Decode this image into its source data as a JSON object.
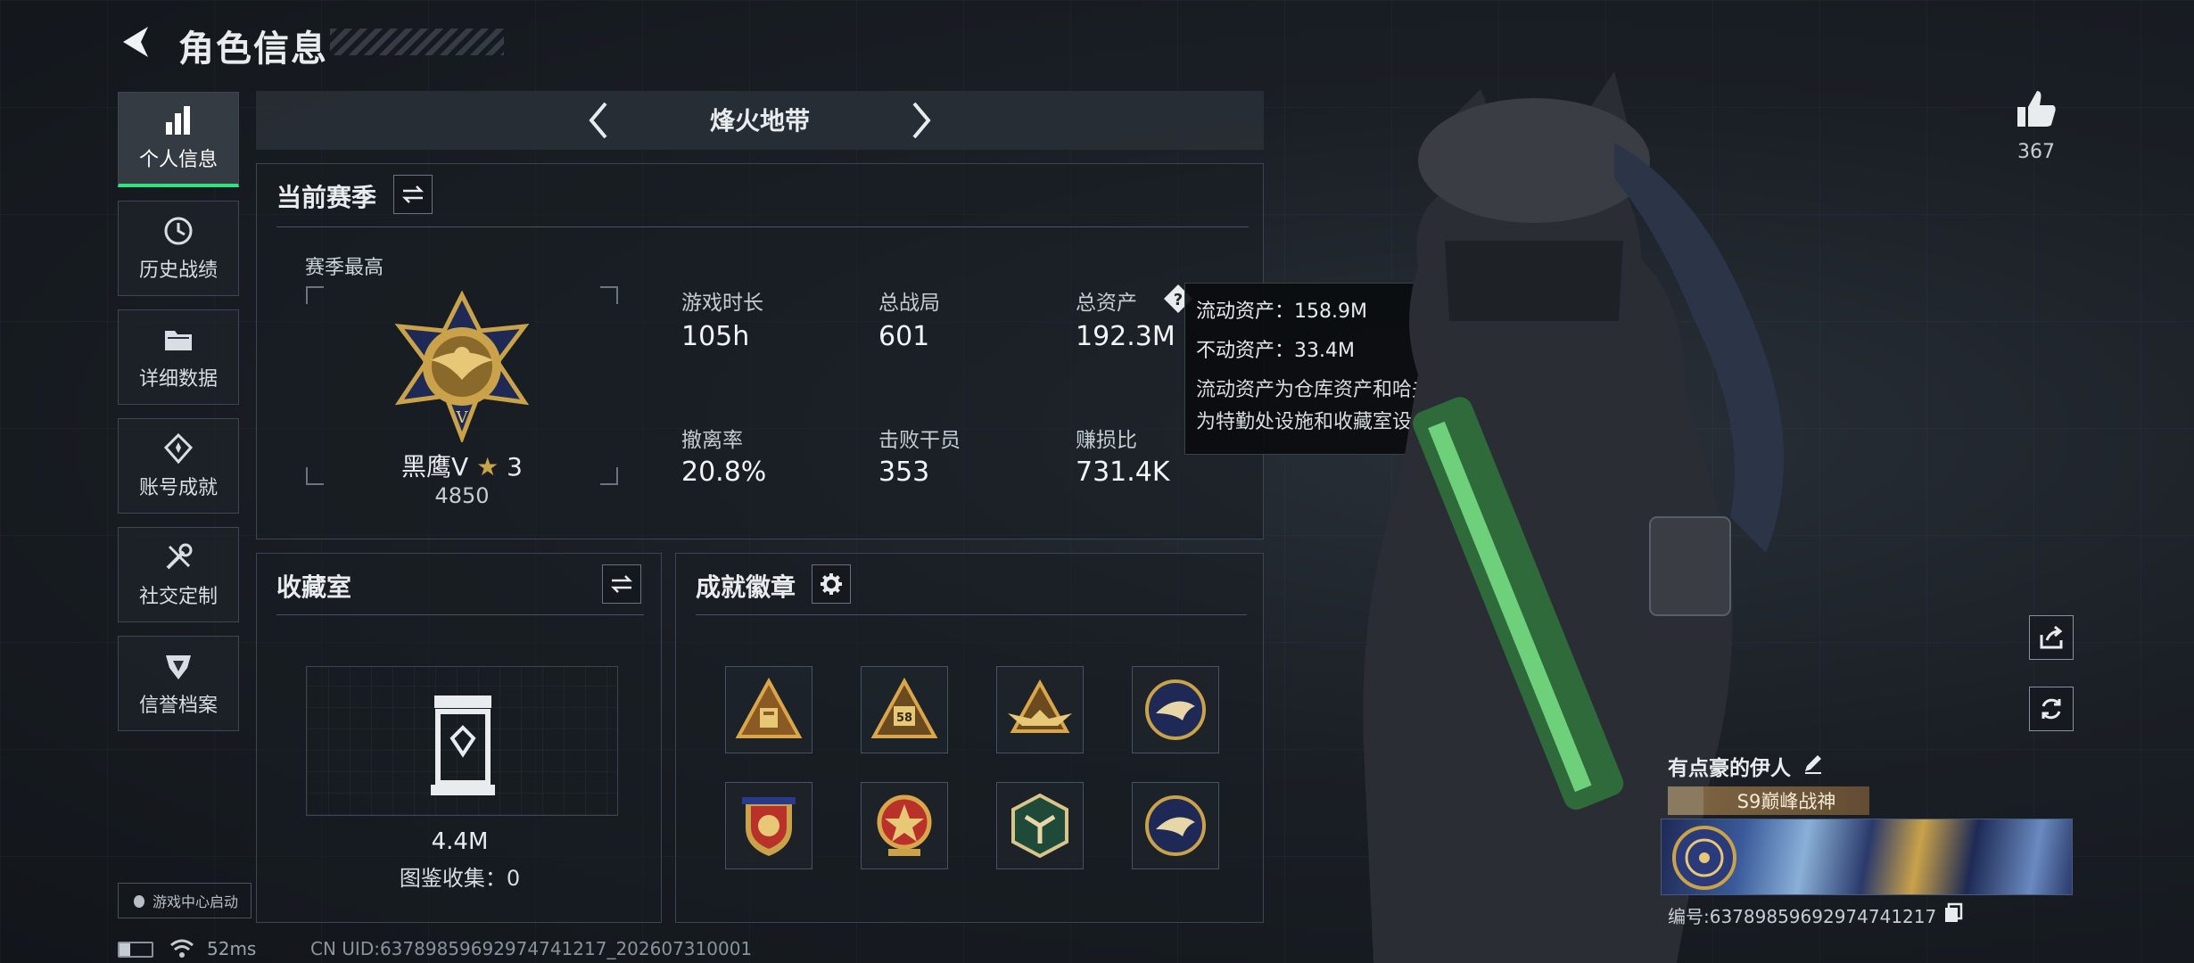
{
  "header": {
    "title": "角色信息"
  },
  "sidebar": {
    "items": [
      {
        "label": "个人信息",
        "icon": "bar-chart-icon",
        "active": true
      },
      {
        "label": "历史战绩",
        "icon": "history-icon"
      },
      {
        "label": "详细数据",
        "icon": "folder-icon"
      },
      {
        "label": "账号成就",
        "icon": "achievement-icon"
      },
      {
        "label": "社交定制",
        "icon": "tools-icon"
      },
      {
        "label": "信誉档案",
        "icon": "reputation-icon"
      }
    ],
    "launch_label": "游戏中心启动"
  },
  "mode": {
    "name": "烽火地带"
  },
  "season": {
    "title": "当前赛季",
    "best_label": "赛季最高",
    "rank_name": "黑鹰V",
    "rank_stars": "3",
    "rank_score": "4850",
    "stats": [
      {
        "label": "游戏时长",
        "value": "105h"
      },
      {
        "label": "总战局",
        "value": "601"
      },
      {
        "label": "总资产",
        "value": "192.3M"
      },
      {
        "label": "撤离率",
        "value": "20.8%"
      },
      {
        "label": "击败干员",
        "value": "353"
      },
      {
        "label": "赚损比",
        "value": "731.4K"
      }
    ]
  },
  "tooltip": {
    "line1": "流动资产：158.9M",
    "line2": "不动资产：33.4M",
    "desc1": "流动资产为仓库资产和哈夫币，不动资产",
    "desc2": "为特勤处设施和收藏室设施"
  },
  "collection": {
    "title": "收藏室",
    "value": "4.4M",
    "catalog": "图鉴收集：0"
  },
  "badges": {
    "title": "成就徽章",
    "items": [
      "triangle-badge-icon",
      "triangle-58-badge-icon",
      "triangle-wings-badge-icon",
      "eagle-badge-icon",
      "shield-badge-icon",
      "star-medal-badge-icon",
      "hexagon-badge-icon",
      "eagle-badge-icon-2"
    ],
    "badge_58": "58"
  },
  "likes": {
    "count": "367"
  },
  "player": {
    "name": "有点豪的伊人",
    "title": "S9巅峰战神",
    "uid_label": "编号:637898596929747412​17"
  },
  "footer": {
    "ping": "52ms",
    "uid": "CN UID:6378985969297474121​7_202607310001"
  },
  "colors": {
    "accent_green": "#2fe37f",
    "gold": "#c9a24a",
    "navy": "#1e2a55"
  }
}
